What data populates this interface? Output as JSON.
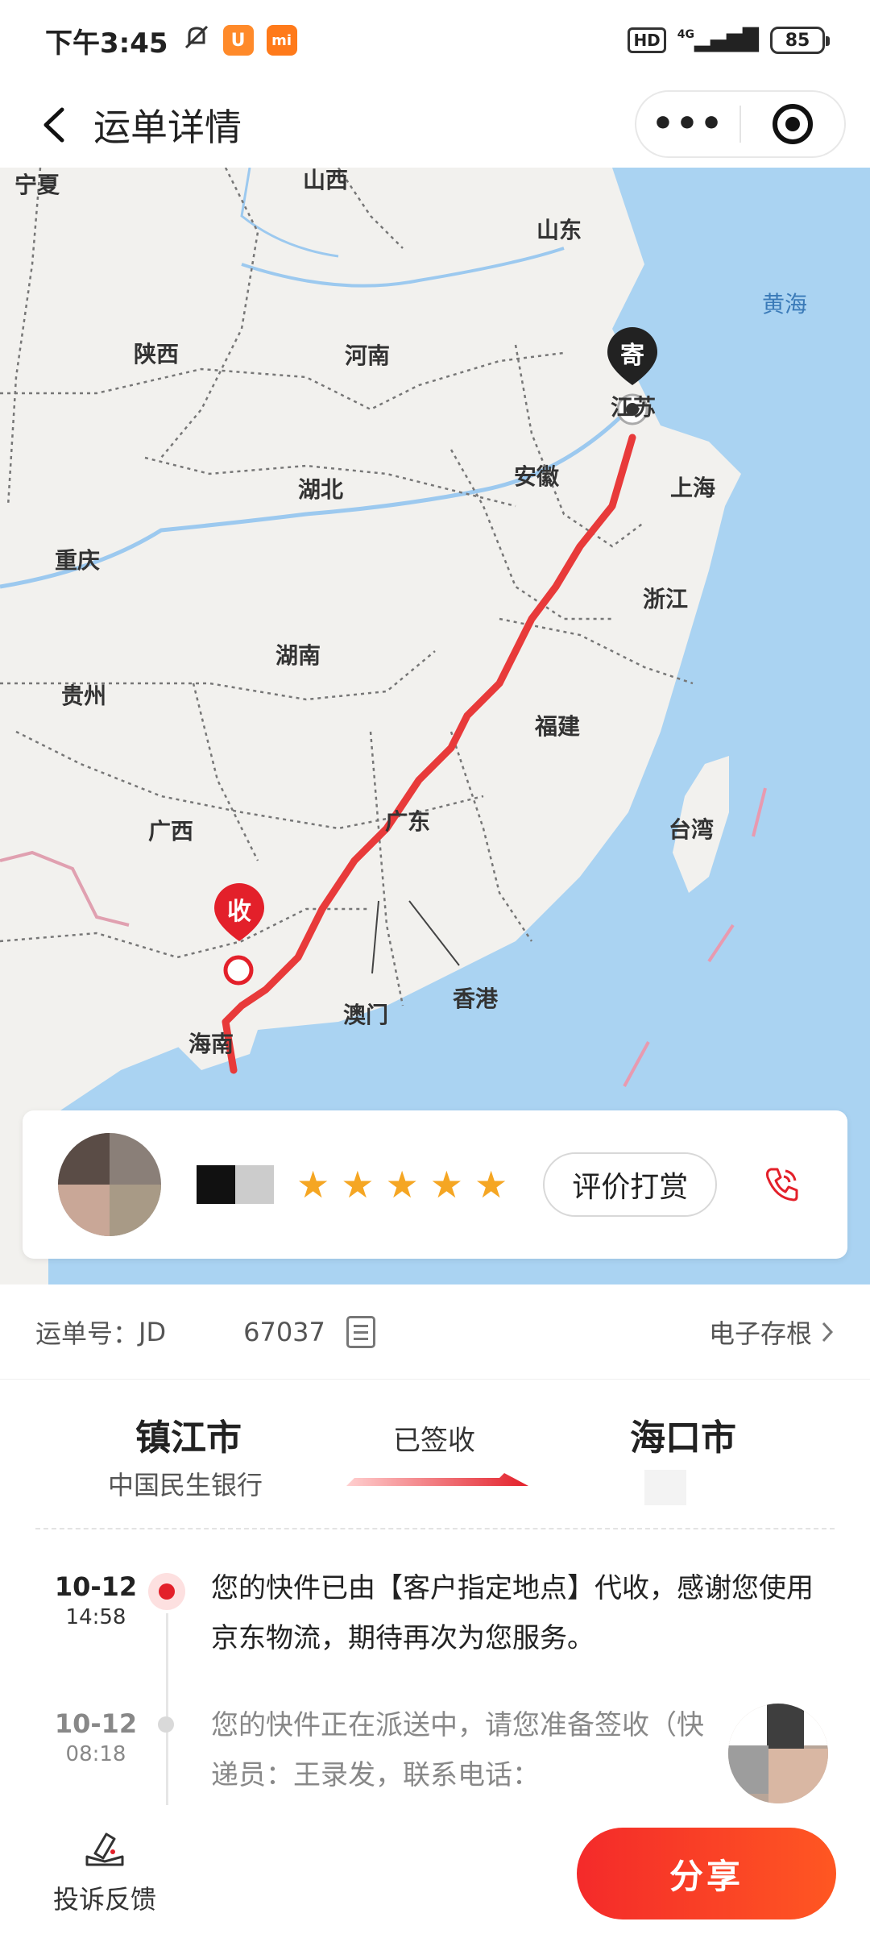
{
  "status_bar": {
    "time": "下午3:45",
    "hd": "HD",
    "network": "4G",
    "battery": "85"
  },
  "header": {
    "title": "运单详情"
  },
  "map": {
    "provinces": [
      {
        "name": "宁夏"
      },
      {
        "name": "山西"
      },
      {
        "name": "山东"
      },
      {
        "name": "陕西"
      },
      {
        "name": "河南"
      },
      {
        "name": "江苏"
      },
      {
        "name": "安徽"
      },
      {
        "name": "上海"
      },
      {
        "name": "湖北"
      },
      {
        "name": "重庆"
      },
      {
        "name": "浙江"
      },
      {
        "name": "湖南"
      },
      {
        "name": "贵州"
      },
      {
        "name": "福建"
      },
      {
        "name": "广东"
      },
      {
        "name": "台湾"
      },
      {
        "name": "广西"
      },
      {
        "name": "澳门"
      },
      {
        "name": "香港"
      },
      {
        "name": "海南"
      }
    ],
    "seas": [
      {
        "name": "黄海"
      }
    ],
    "sender_marker": "寄",
    "receiver_marker": "收"
  },
  "rating_card": {
    "stars": 5,
    "rate_button": "评价打赏"
  },
  "waybill": {
    "label": "运单号：",
    "number": "JD",
    "number_suffix": "67037",
    "e_receipt": "电子存根"
  },
  "route": {
    "origin_city": "镇江市",
    "origin_sub": "中国民生银行",
    "status": "已签收",
    "destination_city": "海口市"
  },
  "timeline": [
    {
      "date": "10-12",
      "time": "14:58",
      "text": "您的快件已由【客户指定地点】代收，感谢您使用京东物流，期待再次为您服务。"
    },
    {
      "date": "10-12",
      "time": "08:18",
      "text": "您的快件正在派送中，请您准备签收（快递员：王录发，联系电话："
    }
  ],
  "bottom": {
    "complaint": "投诉反馈",
    "share": "分享"
  },
  "colors": {
    "accent": "#e3202a",
    "route_line": "#e83a3a",
    "sea": "#aad3f2"
  }
}
